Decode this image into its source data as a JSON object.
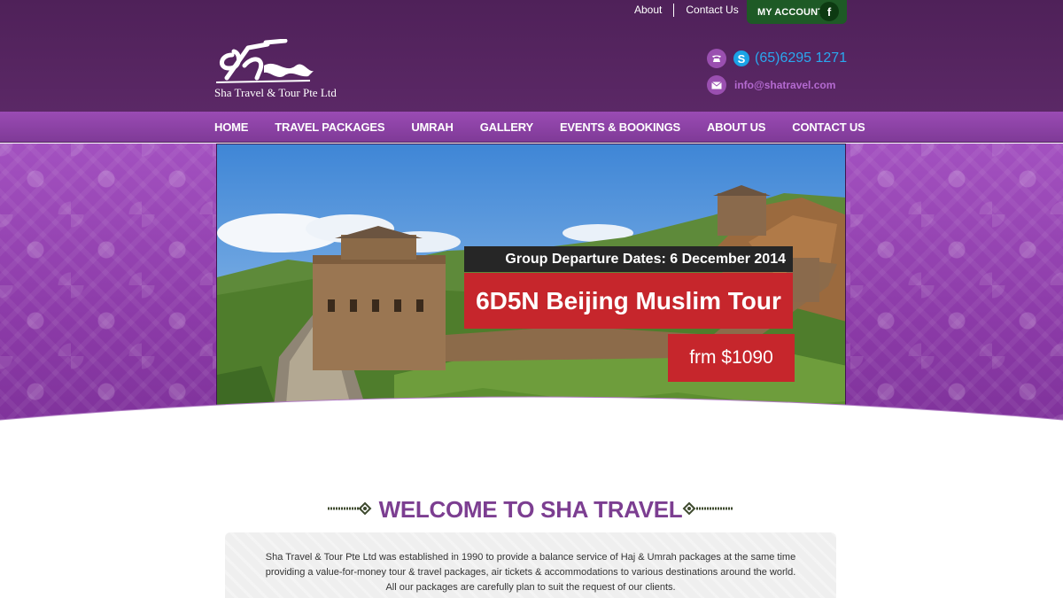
{
  "top_links": {
    "about": "About",
    "contact": "Contact Us"
  },
  "account": {
    "label": "MY ACCOUNT",
    "facebook_glyph": "f"
  },
  "logo": {
    "text": "Sha Travel & Tour Pte Ltd"
  },
  "contact": {
    "phone": "(65)6295 1271",
    "email": "info@shatravel.com",
    "skype_glyph": "S"
  },
  "nav": {
    "items": [
      "HOME",
      "TRAVEL PACKAGES",
      "UMRAH",
      "GALLERY",
      "EVENTS & BOOKINGS",
      "ABOUT US",
      "CONTACT US"
    ]
  },
  "hero": {
    "dates": "Group Departure Dates: 6 December 2014",
    "title": "6D5N Beijing Muslim Tour",
    "price": "frm $1090"
  },
  "welcome": {
    "title": "WELCOME TO SHA TRAVEL",
    "line1": "Sha Travel & Tour Pte Ltd was established in 1990 to provide a balance service of Haj & Umrah packages at the same time",
    "line2": "providing a value-for-money tour & travel packages, air tickets & accommodations to various destinations around the world.",
    "line3": "All our packages are carefully plan to suit the request of our clients."
  },
  "colors": {
    "header": "#4f2159",
    "nav": "#8c43a6",
    "accent_red": "#c6262c",
    "welcome_title": "#7c3e91",
    "account_green": "#1e5a26"
  },
  "icons": [
    "phone-icon",
    "skype-icon",
    "email-icon",
    "facebook-icon",
    "slider-dot-icon",
    "ornament-icon"
  ]
}
